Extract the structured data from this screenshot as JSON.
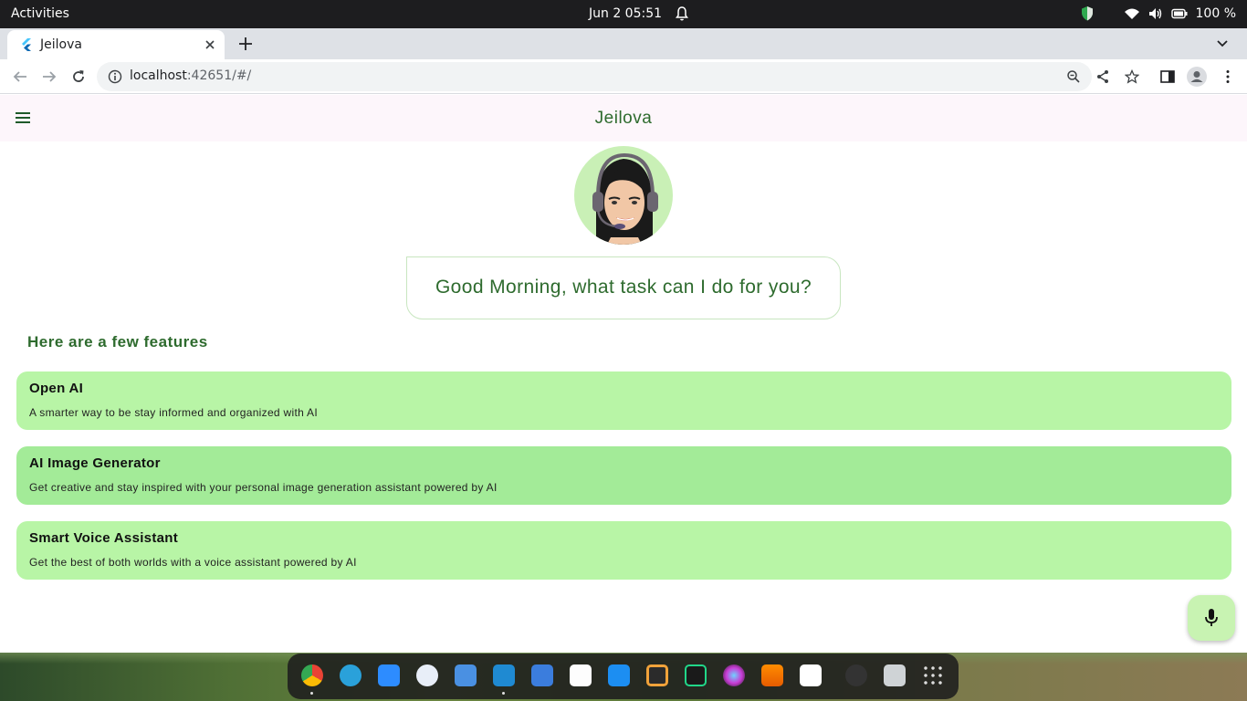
{
  "system_bar": {
    "activities": "Activities",
    "datetime": "Jun 2  05:51",
    "battery_level": "100 %"
  },
  "browser": {
    "tab_title": "Jeilova",
    "url_host": "localhost",
    "url_rest": ":42651/#/"
  },
  "app": {
    "title": "Jeilova",
    "greeting": "Good Morning, what task can I do for you?",
    "features_heading": "Here are a few features",
    "features": [
      {
        "title": "Open AI",
        "description": "A smarter way to be stay informed and organized with AI",
        "color": "#b8f5a6"
      },
      {
        "title": "AI Image Generator",
        "description": "Get creative and stay inspired with your personal image generation assistant powered by AI",
        "color": "#a3eb98"
      },
      {
        "title": "Smart Voice Assistant",
        "description": "Get the best of both worlds with a voice assistant powered by AI",
        "color": "#b8f5a6"
      }
    ],
    "accent_color": "#2e6b2e",
    "fab_icon": "microphone-icon"
  },
  "dock": {
    "apps": [
      "chrome",
      "telegram",
      "zoom",
      "word-online",
      "finder",
      "vscode",
      "docs",
      "itunes",
      "app-store",
      "arc",
      "pycharm",
      "davinci",
      "vlc",
      "slack",
      "globe",
      "trash",
      "app-grid"
    ]
  }
}
